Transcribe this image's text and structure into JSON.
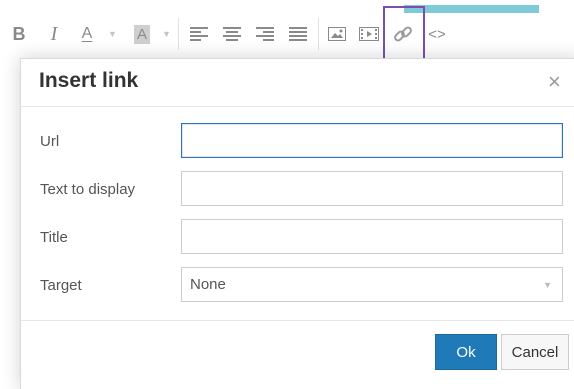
{
  "toolbar": {
    "bold_glyph": "B",
    "italic_glyph": "I",
    "text_color_glyph": "A",
    "bg_color_glyph": "A",
    "caret_glyph": "▼",
    "code_glyph": "<>",
    "icons": [
      "bold-icon",
      "italic-icon",
      "text-color-icon",
      "background-color-icon",
      "align-left-icon",
      "align-center-icon",
      "align-right-icon",
      "align-justify-icon",
      "image-icon",
      "media-icon",
      "link-icon",
      "source-code-icon"
    ],
    "highlight_color": "#7a4fb0"
  },
  "dialog": {
    "title": "Insert link",
    "close_glyph": "×",
    "fields": {
      "url_label": "Url",
      "url_value": "",
      "text_label": "Text to display",
      "text_value": "",
      "title_label": "Title",
      "title_value": "",
      "target_label": "Target",
      "target_value": "None"
    },
    "ok_label": "Ok",
    "cancel_label": "Cancel",
    "primary_color": "#207ab7",
    "focus_color": "#2e73b5"
  }
}
